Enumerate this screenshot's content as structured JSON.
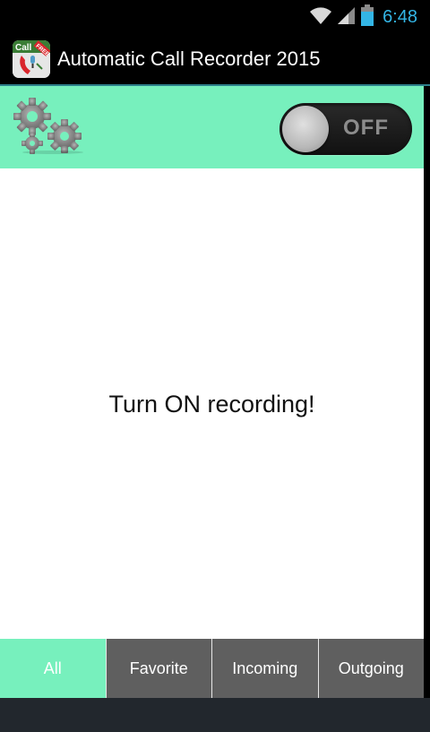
{
  "status_bar": {
    "time": "6:48",
    "wifi_icon": "wifi-icon",
    "signal_icon": "signal-icon",
    "battery_icon": "battery-icon",
    "time_color": "#33b5e5"
  },
  "action_bar": {
    "title": "Automatic Call Recorder 2015",
    "icon_text": "Call",
    "icon_badge": "FREE"
  },
  "control_panel": {
    "background": "#77f0bd",
    "settings_icon": "gears-icon",
    "toggle": {
      "label": "OFF",
      "state": "off"
    }
  },
  "content": {
    "message": "Turn ON recording!"
  },
  "tabs": [
    {
      "label": "All",
      "active": true
    },
    {
      "label": "Favorite",
      "active": false
    },
    {
      "label": "Incoming",
      "active": false
    },
    {
      "label": "Outgoing",
      "active": false
    }
  ]
}
